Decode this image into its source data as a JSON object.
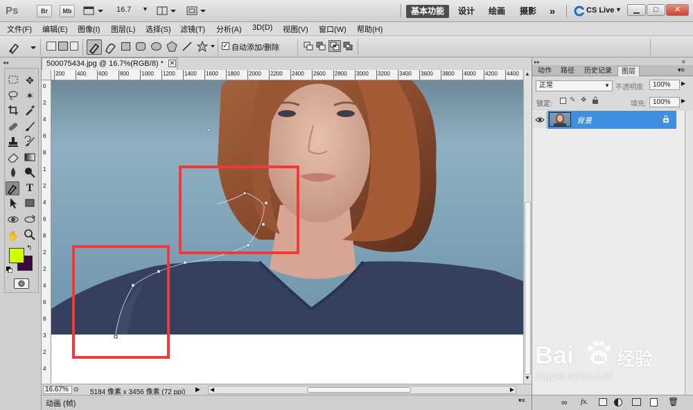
{
  "titlebar": {
    "logo": "Ps",
    "bridge": "Br",
    "mini_bridge": "Mb",
    "zoom": "16.7",
    "workspaces": [
      "基本功能",
      "设计",
      "绘画",
      "摄影"
    ],
    "more": "»",
    "cs_live": "CS Live",
    "win_min": "▁",
    "win_max": "□",
    "win_close": "✕"
  },
  "menu": [
    "文件(F)",
    "编辑(E)",
    "图像(I)",
    "图层(L)",
    "选择(S)",
    "滤镜(T)",
    "分析(A)",
    "3D(D)",
    "视图(V)",
    "窗口(W)",
    "帮助(H)"
  ],
  "options": {
    "auto_add_delete": "自动添加/删除",
    "auto_add_checked": true
  },
  "document": {
    "tab_title": "500075434.jpg @ 16.7%(RGB/8) *",
    "zoom": "16.67%",
    "status": "5184 像素 x 3456 像素 (72 ppi)",
    "h_ruler": [
      "200",
      "400",
      "600",
      "800",
      "1000",
      "1200",
      "1400",
      "1600",
      "1800",
      "2000",
      "2200",
      "2400",
      "2600",
      "2800",
      "3000",
      "3200",
      "3400",
      "3600",
      "3800",
      "4000",
      "4200",
      "4400"
    ],
    "v_ruler": [
      "0",
      "2",
      "4",
      "6",
      "8",
      "1",
      "2",
      "4",
      "6",
      "8",
      "2",
      "2",
      "4",
      "6",
      "8",
      "3",
      "2",
      "4"
    ]
  },
  "animation_panel": {
    "title": "动画 (帧)"
  },
  "layers_panel": {
    "tabs": [
      "动作",
      "路径",
      "历史记录",
      "图层"
    ],
    "active_tab": "图层",
    "blend_mode": "正常",
    "opacity_label": "不透明度:",
    "opacity_value": "100%",
    "lock_label": "锁定:",
    "fill_label": "填充:",
    "fill_value": "100%",
    "layers": [
      {
        "name": "背景",
        "visible": true,
        "locked": true,
        "selected": true
      }
    ]
  },
  "watermark": {
    "brand": "Bai",
    "brand2": "经验",
    "url": "jingyan.baidu.com"
  },
  "colors": {
    "foreground": "#ccff00",
    "background": "#3a0a3e",
    "highlight_box": "#f03a3a",
    "selected_layer": "#3f8fde"
  }
}
